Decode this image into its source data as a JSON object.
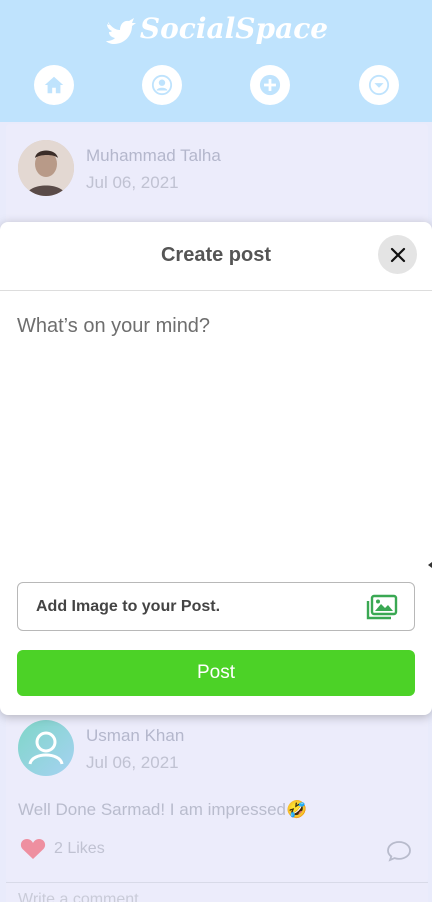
{
  "app": {
    "brand_name": "SocialSpace"
  },
  "posts": [
    {
      "author": "Muhammad Talha",
      "date": "Jul 06, 2021"
    },
    {
      "author": "Usman Khan",
      "date": "Jul 06, 2021",
      "text": "Well Done Sarmad! I am impressed",
      "emoji": "🤣",
      "likes_label": "2 Likes",
      "comment_placeholder": "Write a comment..."
    }
  ],
  "modal": {
    "title": "Create post",
    "textarea_placeholder": "What’s on your mind?",
    "add_image_label": "Add Image to your Post.",
    "post_button_label": "Post"
  },
  "colors": {
    "header_bg": "#bfe3fd",
    "post_button": "#4cd227",
    "like_heart": "#ee8fa0",
    "image_icon": "#3aa853"
  }
}
